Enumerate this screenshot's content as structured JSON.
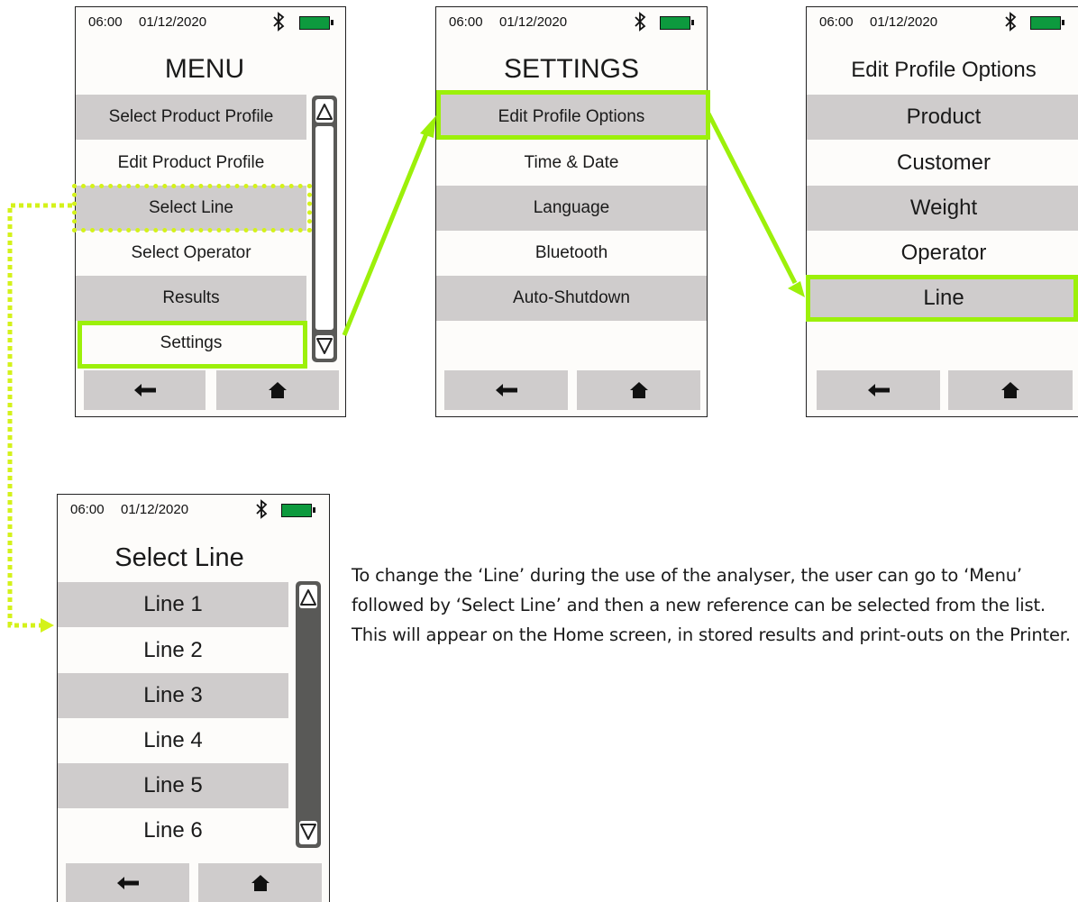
{
  "status": {
    "time": "06:00",
    "date": "01/12/2020"
  },
  "menu_screen": {
    "title": "MENU",
    "items": [
      "Select Product Profile",
      "Edit Product Profile",
      "Select Line",
      "Select Operator",
      "Results",
      "Settings"
    ]
  },
  "settings_screen": {
    "title": "SETTINGS",
    "items": [
      "Edit Profile Options",
      "Time & Date",
      "Language",
      "Bluetooth",
      "Auto-Shutdown"
    ]
  },
  "edit_profile_screen": {
    "title": "Edit Profile Options",
    "items": [
      "Product",
      "Customer",
      "Weight",
      "Operator",
      "Line"
    ]
  },
  "select_line_screen": {
    "title": "Select Line",
    "items": [
      "Line 1",
      "Line 2",
      "Line 3",
      "Line 4",
      "Line 5",
      "Line 6"
    ]
  },
  "description": "To change the ‘Line’ during the use of the analyser, the user can go to ‘Menu’ followed by ‘Select Line’ and then a new reference can be selected from the list. This will appear on the Home screen, in stored results and print-outs on the Printer.",
  "icons": [
    "bluetooth-icon",
    "battery-icon",
    "scroll-up-icon",
    "scroll-down-icon",
    "back-arrow-icon",
    "home-icon"
  ],
  "colors": {
    "highlight": "#9cf00a",
    "dotted_highlight": "#d4f21a",
    "row_shade": "#cfcccc",
    "battery": "#0d9a3e",
    "scrollbar": "#595957"
  }
}
